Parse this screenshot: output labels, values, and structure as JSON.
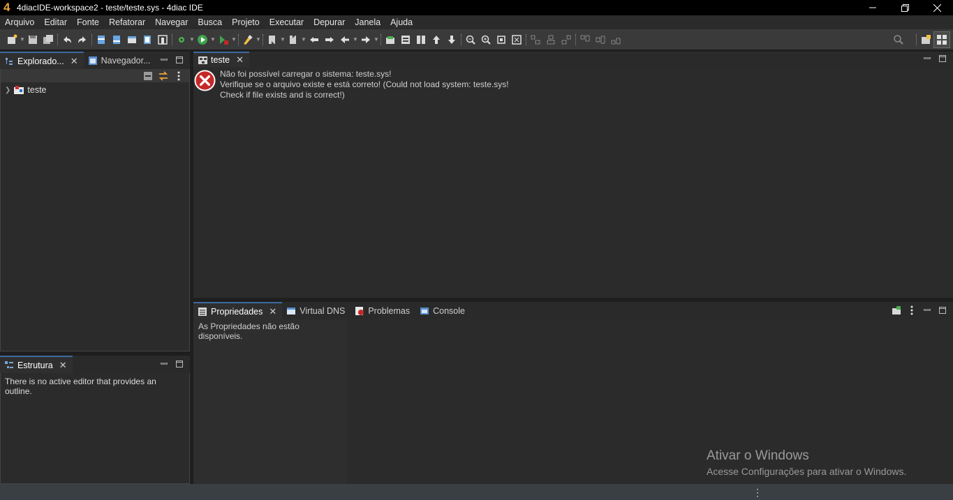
{
  "window": {
    "title": "4diacIDE-workspace2 - teste/teste.sys - 4diac IDE",
    "controls": [
      "minimize-icon",
      "restore-icon",
      "close-icon"
    ]
  },
  "menu": [
    "Arquivo",
    "Editar",
    "Fonte",
    "Refatorar",
    "Navegar",
    "Busca",
    "Projeto",
    "Executar",
    "Depurar",
    "Janela",
    "Ajuda"
  ],
  "explorer": {
    "tabs": [
      {
        "label": "Explorado...",
        "icon": "system-explorer-icon",
        "active": true
      },
      {
        "label": "Navegador...",
        "icon": "navigator-icon",
        "active": false
      }
    ],
    "tree": [
      {
        "label": "teste",
        "icon": "system-project-icon",
        "expanded": false
      }
    ]
  },
  "outline": {
    "tab": "Estrutura",
    "message": "There is no active editor that provides an outline."
  },
  "editor": {
    "tab": "teste",
    "error_lines": [
      "Não foi possível carregar o sistema: teste.sys!",
      "Verifique se o arquivo existe e está correto! (Could not load system: teste.sys!",
      "Check if file exists and is correct!)"
    ]
  },
  "bottom": {
    "tabs": [
      {
        "label": "Propriedades",
        "icon": "properties-icon",
        "active": true
      },
      {
        "label": "Virtual DNS",
        "icon": "virtual-dns-icon",
        "active": false
      },
      {
        "label": "Problemas",
        "icon": "problems-icon",
        "active": false
      },
      {
        "label": "Console",
        "icon": "console-icon",
        "active": false
      }
    ],
    "message": "As Propriedades não estão disponíveis."
  },
  "watermark": {
    "title": "Ativar o Windows",
    "subtitle": "Acesse Configurações para ativar o Windows."
  },
  "colors": {
    "accent": "#3d6a9e",
    "error": "#c62828",
    "logo": "#e9a33a"
  }
}
